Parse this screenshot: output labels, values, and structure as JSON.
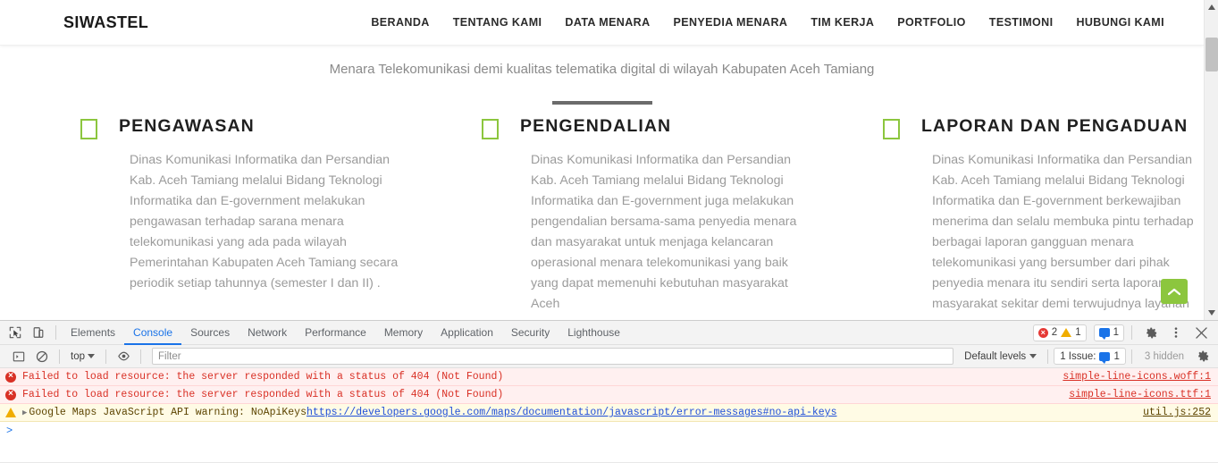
{
  "site": {
    "brand": "SIWASTEL",
    "nav": [
      "BERANDA",
      "TENTANG KAMI",
      "DATA MENARA",
      "PENYEDIA MENARA",
      "TIM KERJA",
      "PORTFOLIO",
      "TESTIMONI",
      "HUBUNGI KAMI"
    ],
    "intro": {
      "clipped_line": "",
      "line": "Menara Telekomunikasi demi kualitas telematika digital di wilayah Kabupaten Aceh Tamiang"
    },
    "cards": [
      {
        "title": "PENGAWASAN",
        "body": "Dinas Komunikasi Informatika dan Persandian Kab. Aceh Tamiang melalui Bidang Teknologi Informatika dan E-government melakukan pengawasan terhadap sarana menara telekomunikasi yang ada pada wilayah Pemerintahan Kabupaten Aceh Tamiang secara periodik setiap tahunnya (semester I dan II) ."
      },
      {
        "title": "PENGENDALIAN",
        "body": "Dinas Komunikasi Informatika dan Persandian Kab. Aceh Tamiang melalui Bidang Teknologi Informatika dan E-government juga melakukan pengendalian bersama-sama penyedia menara dan masyarakat untuk menjaga kelancaran operasional menara telekomunikasi yang baik yang dapat memenuhi kebutuhan masyarakat Aceh"
      },
      {
        "title": "LAPORAN DAN PENGADUAN",
        "body": "Dinas Komunikasi Informatika dan Persandian Kab. Aceh Tamiang melalui Bidang Teknologi Informatika dan E-government berkewajiban menerima dan selalu membuka pintu terhadap berbagai laporan gangguan menara telekomunikasi yang bersumber dari pihak penyedia menara itu sendiri serta laporan masyarakat sekitar demi terwujudnya layanan"
      }
    ],
    "accent_color": "#8cc63e",
    "scroll_top_icon": "chevron-up-icon"
  },
  "devtools": {
    "tabs": [
      {
        "label": "Elements",
        "active": false
      },
      {
        "label": "Console",
        "active": true
      },
      {
        "label": "Sources",
        "active": false
      },
      {
        "label": "Network",
        "active": false
      },
      {
        "label": "Performance",
        "active": false
      },
      {
        "label": "Memory",
        "active": false
      },
      {
        "label": "Application",
        "active": false
      },
      {
        "label": "Security",
        "active": false
      },
      {
        "label": "Lighthouse",
        "active": false
      }
    ],
    "left_icons": [
      "inspect-element-icon",
      "device-toolbar-icon"
    ],
    "counters": {
      "errors": "2",
      "warnings": "1",
      "messages": "1"
    },
    "right_icons": [
      "settings-gear-icon",
      "more-options-icon",
      "close-icon"
    ],
    "filterbar": {
      "execute_icon": "console-sidebar-icon",
      "clear_icon": "clear-console-icon",
      "context": "top",
      "eye_icon": "live-expression-icon",
      "filter_placeholder": "Filter",
      "filter_value": "",
      "levels_label": "Default levels",
      "issues_label": "1 Issue:",
      "issues_count": "1",
      "hidden_label": "3 hidden",
      "settings_icon": "console-settings-gear-icon"
    },
    "messages": [
      {
        "type": "error",
        "icon": "error-circle-icon",
        "text": "Failed to load resource: the server responded with a status of 404 (Not Found)",
        "source": "simple-line-icons.woff:1",
        "has_arrow": false,
        "link": ""
      },
      {
        "type": "error",
        "icon": "error-circle-icon",
        "text": "Failed to load resource: the server responded with a status of 404 (Not Found)",
        "source": "simple-line-icons.ttf:1",
        "has_arrow": false,
        "link": ""
      },
      {
        "type": "warning",
        "icon": "warning-triangle-icon",
        "text": "Google Maps JavaScript API warning: NoApiKeys ",
        "link": "https://developers.google.com/maps/documentation/javascript/error-messages#no-api-keys",
        "source": "util.js:252",
        "has_arrow": true
      }
    ],
    "prompt": ">"
  }
}
